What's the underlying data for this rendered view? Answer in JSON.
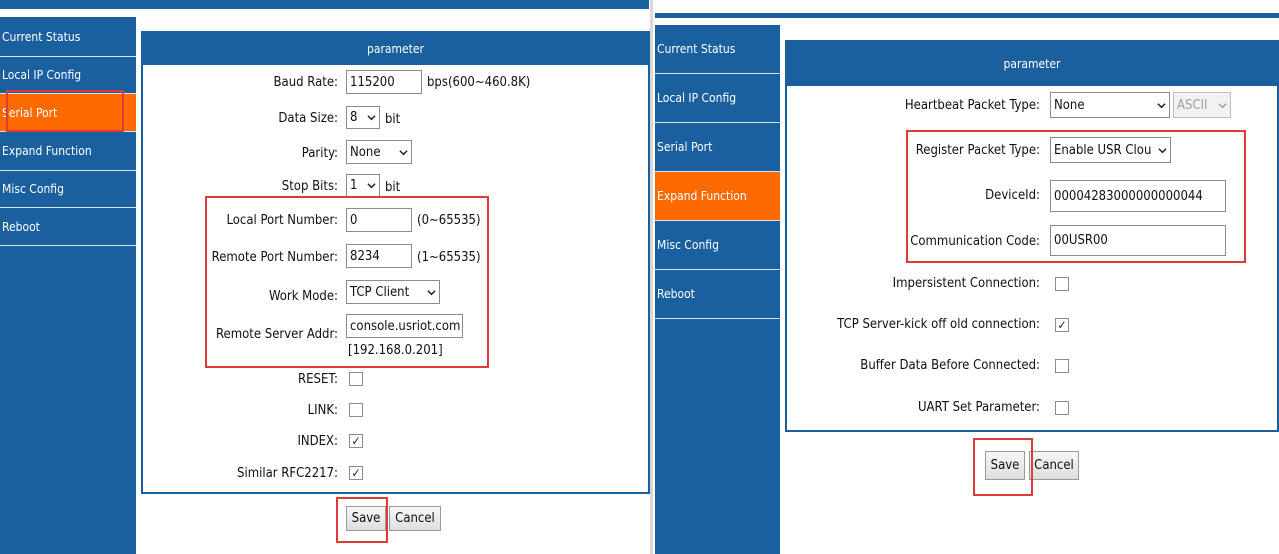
{
  "left": {
    "sidebar": [
      "Current Status",
      "Local IP Config",
      "Serial Port",
      "Expand Function",
      "Misc Config",
      "Reboot"
    ],
    "active_item": "Serial Port",
    "header": "parameter",
    "baud_rate": {
      "label": "Baud Rate:",
      "value": "115200",
      "hint": "bps(600~460.8K)"
    },
    "data_size": {
      "label": "Data Size:",
      "value": "8",
      "unit": "bit"
    },
    "parity": {
      "label": "Parity:",
      "value": "None"
    },
    "stop_bits": {
      "label": "Stop Bits:",
      "value": "1",
      "unit": "bit"
    },
    "local_port": {
      "label": "Local Port Number:",
      "value": "0",
      "hint": "(0~65535)"
    },
    "remote_port": {
      "label": "Remote Port Number:",
      "value": "8234",
      "hint": "(1~65535)"
    },
    "work_mode": {
      "label": "Work Mode:",
      "value": "TCP Client"
    },
    "remote_addr": {
      "label": "Remote Server Addr:",
      "value": "console.usriot.com",
      "resolved": "[192.168.0.201]"
    },
    "reset": {
      "label": "RESET:",
      "checked": false
    },
    "link": {
      "label": "LINK:",
      "checked": false
    },
    "index": {
      "label": "INDEX:",
      "checked": true
    },
    "rfc2217": {
      "label": "Similar RFC2217:",
      "checked": true
    },
    "save": "Save",
    "cancel": "Cancel"
  },
  "right": {
    "sidebar": [
      "Current Status",
      "Local IP Config",
      "Serial Port",
      "Expand Function",
      "Misc Config",
      "Reboot"
    ],
    "active_item": "Expand Function",
    "header": "parameter",
    "heartbeat": {
      "label": "Heartbeat Packet Type:",
      "value": "None",
      "format": "ASCII"
    },
    "register": {
      "label": "Register Packet Type:",
      "value": "Enable USR Clou"
    },
    "device_id": {
      "label": "DeviceId:",
      "value": "00004283000000000044"
    },
    "comm_code": {
      "label": "Communication Code:",
      "value": "00USR00"
    },
    "impersistent": {
      "label": "Impersistent Connection:",
      "checked": false
    },
    "kick_off": {
      "label": "TCP Server-kick off old connection:",
      "checked": true
    },
    "buffer": {
      "label": "Buffer Data Before Connected:",
      "checked": false
    },
    "uart": {
      "label": "UART Set Parameter:",
      "checked": false
    },
    "save": "Save",
    "cancel": "Cancel"
  },
  "colors": {
    "nav_blue": "#1a5f9e",
    "active_orange": "#ff6a00",
    "highlight_red": "#e03a3a"
  },
  "icons": {
    "dropdown": "chevron-down-icon",
    "check": "checkmark-icon"
  }
}
